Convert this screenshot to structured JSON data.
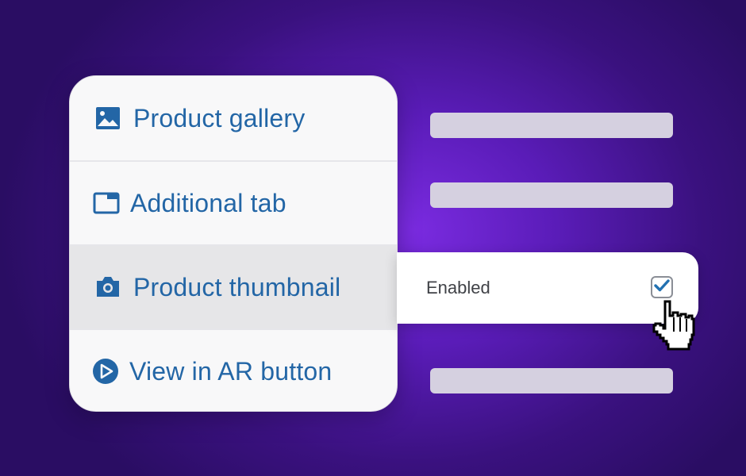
{
  "menu": {
    "items": [
      {
        "label": "Product gallery",
        "icon": "image-icon"
      },
      {
        "label": "Additional tab",
        "icon": "tab-window-icon"
      },
      {
        "label": "Product thumbnail",
        "icon": "camera-icon",
        "active": true
      },
      {
        "label": "View in AR button",
        "icon": "play-circle-icon"
      }
    ]
  },
  "settings_panel": {
    "enabled_label": "Enabled",
    "enabled_checked": true
  },
  "colors": {
    "link_blue": "#2366a6",
    "checkmark_blue": "#2271b1",
    "active_row": "#e6e6e8",
    "placeholder": "#d5d0e0"
  }
}
